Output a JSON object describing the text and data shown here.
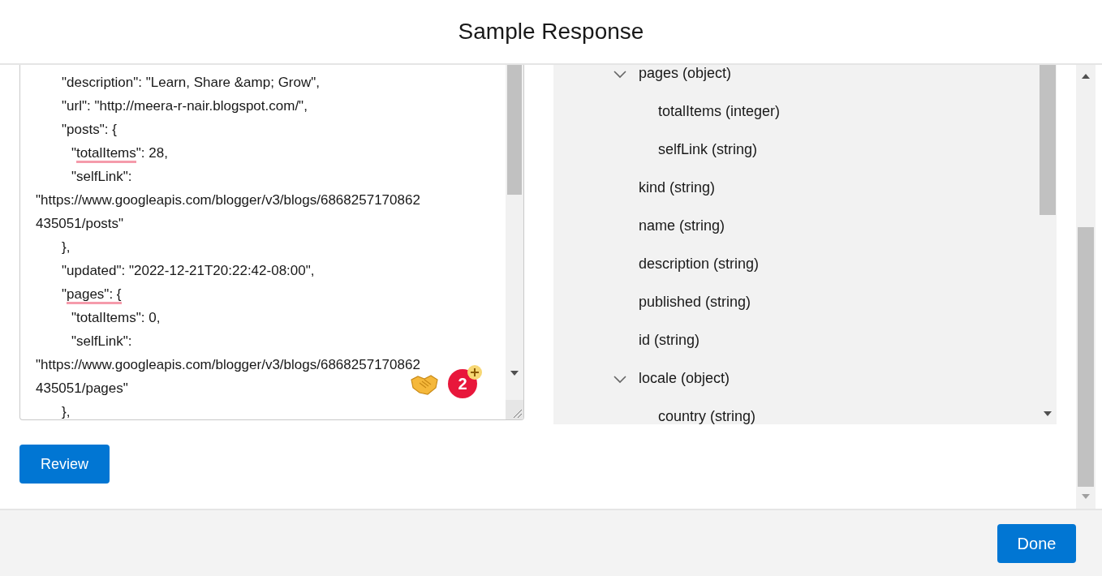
{
  "modal": {
    "title": "Sample Response"
  },
  "code_lines": [
    {
      "kind": "outer",
      "parts": [
        {
          "text": "\"description\": \"Learn, Share &amp; Grow\",",
          "flagged": false
        }
      ]
    },
    {
      "kind": "outer",
      "parts": [
        {
          "text": "\"url\": \"http://meera-r-nair.blogspot.com/\",",
          "flagged": false
        }
      ]
    },
    {
      "kind": "outer",
      "parts": [
        {
          "text": "\"posts\": {",
          "flagged": false
        }
      ]
    },
    {
      "kind": "inner",
      "parts": [
        {
          "text": "\"",
          "flagged": false
        },
        {
          "text": "totalItems",
          "flagged": true
        },
        {
          "text": "\": 28,",
          "flagged": false
        }
      ]
    },
    {
      "kind": "inner",
      "parts": [
        {
          "text": "\"selfLink\":",
          "flagged": false
        }
      ]
    },
    {
      "kind": "wrapped",
      "parts": [
        {
          "text": "\"https://www.googleapis.com/blogger/v3/blogs/6868257170862",
          "flagged": false
        }
      ]
    },
    {
      "kind": "wrapped",
      "parts": [
        {
          "text": "435051/posts\"",
          "flagged": false
        }
      ]
    },
    {
      "kind": "outer",
      "parts": [
        {
          "text": "},",
          "flagged": false
        }
      ]
    },
    {
      "kind": "outer",
      "parts": [
        {
          "text": "\"updated\": \"2022-12-21T20:22:42-08:00\",",
          "flagged": false
        }
      ]
    },
    {
      "kind": "outer",
      "parts": [
        {
          "text": "\"",
          "flagged": false
        },
        {
          "text": "pages\": {",
          "flagged": true
        }
      ]
    },
    {
      "kind": "inner",
      "parts": [
        {
          "text": "\"totalItems\": 0,",
          "flagged": false
        }
      ]
    },
    {
      "kind": "inner",
      "parts": [
        {
          "text": "\"selfLink\":",
          "flagged": false
        }
      ]
    },
    {
      "kind": "wrapped",
      "parts": [
        {
          "text": "\"https://www.googleapis.com/blogger/v3/blogs/6868257170862",
          "flagged": false
        }
      ]
    },
    {
      "kind": "wrapped",
      "parts": [
        {
          "text": "435051/pages\"",
          "flagged": false
        }
      ]
    },
    {
      "kind": "outer",
      "parts": [
        {
          "text": "},",
          "flagged": false
        }
      ]
    }
  ],
  "assistant_badge": {
    "count": "2"
  },
  "schema_tree": [
    {
      "label": "pages (object)",
      "expanded": true,
      "children": [
        {
          "label": "totalItems (integer)"
        },
        {
          "label": "selfLink (string)"
        }
      ]
    },
    {
      "label": "kind (string)"
    },
    {
      "label": "name (string)"
    },
    {
      "label": "description (string)"
    },
    {
      "label": "published (string)"
    },
    {
      "label": "id (string)"
    },
    {
      "label": "locale (object)",
      "expanded": true,
      "children": [
        {
          "label": "country (string)"
        }
      ]
    }
  ],
  "buttons": {
    "review": "Review",
    "done": "Done"
  }
}
